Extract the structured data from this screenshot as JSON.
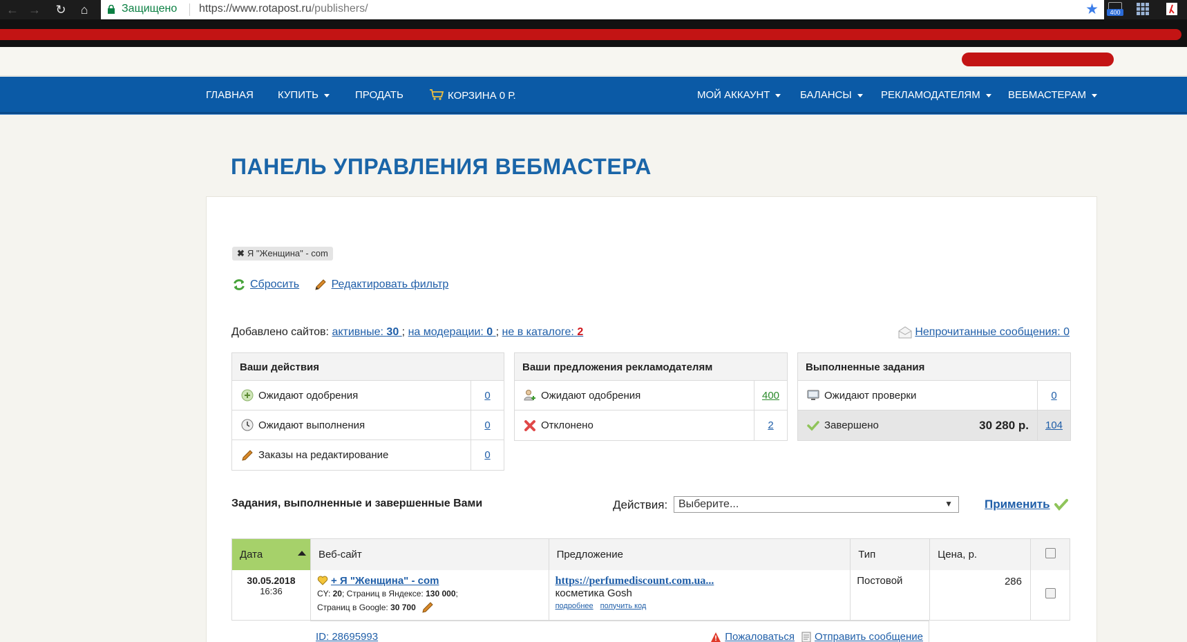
{
  "browser": {
    "secure_label": "Защищено",
    "url_host": "https://www.rotapost.ru",
    "url_path": "/publishers/",
    "ext_badge": "400"
  },
  "nav": {
    "home": "ГЛАВНАЯ",
    "buy": "КУПИТЬ",
    "sell": "ПРОДАТЬ",
    "cart": "КОРЗИНА 0 Р.",
    "account": "МОЙ АККАУНТ",
    "balances": "БАЛАНСЫ",
    "advertisers": "РЕКЛАМОДАТЕЛЯМ",
    "webmasters": "ВЕБМАСТЕРАМ"
  },
  "page": {
    "title": "ПАНЕЛЬ УПРАВЛЕНИЯ ВЕБМАСТЕРА"
  },
  "filter": {
    "chip_label": "Я \"Женщина\" - com",
    "reset": "Сбросить",
    "edit": "Редактировать фильтр"
  },
  "sites": {
    "prefix": "Добавлено сайтов:",
    "active_label": "активные:",
    "active_count": "30",
    "moderation_label": "на модерации:",
    "moderation_count": "0",
    "notcatalog_label": "не в каталоге:",
    "notcatalog_count": "2",
    "sep": ";",
    "unread": "Непрочитанные сообщения: 0"
  },
  "your_actions": {
    "title": "Ваши действия",
    "rows": [
      {
        "label": "Ожидают одобрения",
        "count": "0"
      },
      {
        "label": "Ожидают выполнения",
        "count": "0"
      },
      {
        "label": "Заказы на редактирование",
        "count": "0"
      }
    ]
  },
  "offers": {
    "title": "Ваши предложения рекламодателям",
    "rows": [
      {
        "label": "Ожидают одобрения",
        "count": "400"
      },
      {
        "label": "Отклонено",
        "count": "2"
      }
    ]
  },
  "done": {
    "title": "Выполненные задания",
    "rows": [
      {
        "label": "Ожидают проверки",
        "count": "0"
      },
      {
        "label": "Завершено",
        "amount": "30 280 р.",
        "count": "104"
      }
    ]
  },
  "tasks": {
    "title": "Задания, выполненные и завершенные Вами",
    "actions_label": "Действия:",
    "select_value": "Выберите...",
    "apply": "Применить",
    "columns": [
      "Дата",
      "Веб-сайт",
      "Предложение",
      "Тип",
      "Цена, р."
    ],
    "rows": [
      {
        "date": "30.05.2018",
        "time": "16:36",
        "site_name": "+ Я \"Женщина\" - com",
        "cy_label": "CY:",
        "cy": "20",
        "yandex_label": "; Страниц в Яндексе:",
        "yandex": "130 000",
        "google_label": "Страниц в Google:",
        "google": "30 700",
        "offer_url": "https://perfumediscount.com.ua...",
        "offer_text": "косметика Gosh",
        "more": "подробнее",
        "get_code": "получить код",
        "type": "Постовой",
        "price": "286",
        "id": "ID: 28695993",
        "complain": "Пожаловаться",
        "send_message": "Отправить сообщение"
      }
    ]
  }
}
